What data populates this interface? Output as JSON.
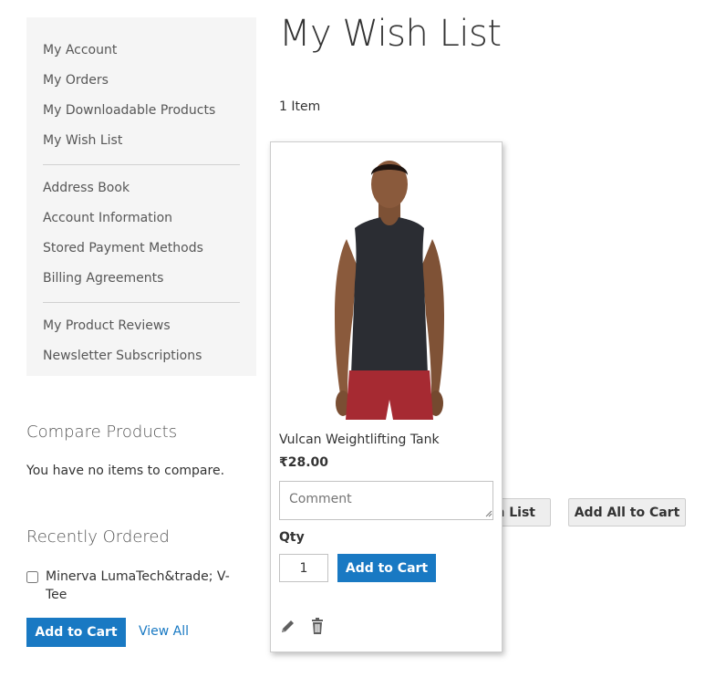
{
  "sidebar": {
    "group1": [
      "My Account",
      "My Orders",
      "My Downloadable Products",
      "My Wish List"
    ],
    "group2": [
      "Address Book",
      "Account Information",
      "Stored Payment Methods",
      "Billing Agreements"
    ],
    "group3": [
      "My Product Reviews",
      "Newsletter Subscriptions"
    ]
  },
  "compare": {
    "title": "Compare Products",
    "empty_text": "You have no items to compare."
  },
  "recently_ordered": {
    "title": "Recently Ordered",
    "item_name": "Minerva LumaTech&trade; V-Tee",
    "add_to_cart": "Add to Cart",
    "view_all": "View All"
  },
  "main": {
    "title": "My Wish List",
    "item_count": "1 Item",
    "update_button_partial": "h List",
    "add_all_button": "Add All to Cart"
  },
  "product": {
    "name": "Vulcan Weightlifting Tank",
    "price": "₹28.00",
    "comment_placeholder": "Comment",
    "qty_label": "Qty",
    "qty_value": "1",
    "add_to_cart": "Add to Cart",
    "icons": [
      "pencil-icon",
      "trash-icon"
    ]
  },
  "colors": {
    "primary": "#1979c3",
    "sidebar_bg": "#f5f5f5"
  }
}
